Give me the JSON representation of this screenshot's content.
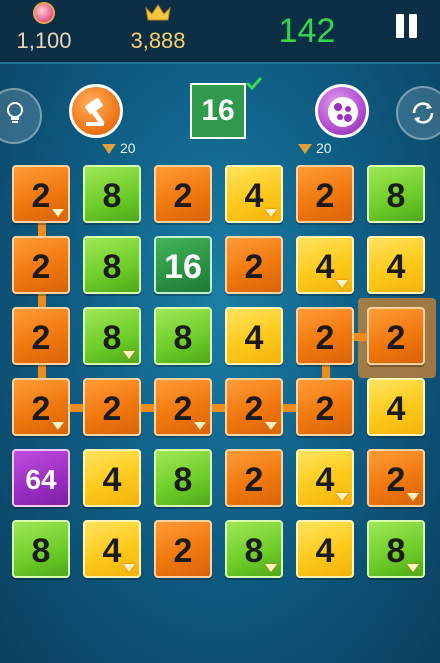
{
  "header": {
    "coins": "1,100",
    "best": "3,888",
    "score": "142"
  },
  "powerups": {
    "hammer_cost": "20",
    "shuffle_cost": "20",
    "target_tile": "16"
  },
  "colors": {
    "orange": "#f0780e",
    "green": "#6ccc28",
    "yellow": "#fdc91b",
    "dark_green": "#2c9444",
    "purple": "#9b2fc4",
    "score_green": "#32d84a"
  },
  "board": {
    "rows": [
      [
        {
          "v": "2",
          "c": "orange",
          "gem": true
        },
        {
          "v": "8",
          "c": "green",
          "gem": false
        },
        {
          "v": "2",
          "c": "orange",
          "gem": false
        },
        {
          "v": "4",
          "c": "yellow",
          "gem": true
        },
        {
          "v": "2",
          "c": "orange",
          "gem": false
        },
        {
          "v": "8",
          "c": "green",
          "gem": false
        }
      ],
      [
        {
          "v": "2",
          "c": "orange",
          "gem": false
        },
        {
          "v": "8",
          "c": "green",
          "gem": false
        },
        {
          "v": "16",
          "c": "dkgreen",
          "gem": false
        },
        {
          "v": "2",
          "c": "orange",
          "gem": false
        },
        {
          "v": "4",
          "c": "yellow",
          "gem": true
        },
        {
          "v": "4",
          "c": "yellow",
          "gem": false
        }
      ],
      [
        {
          "v": "2",
          "c": "orange",
          "gem": false
        },
        {
          "v": "8",
          "c": "green",
          "gem": true
        },
        {
          "v": "8",
          "c": "green",
          "gem": false
        },
        {
          "v": "4",
          "c": "yellow",
          "gem": false
        },
        {
          "v": "2",
          "c": "orange",
          "gem": false
        },
        {
          "v": "2",
          "c": "orange",
          "gem": false
        }
      ],
      [
        {
          "v": "2",
          "c": "orange",
          "gem": true
        },
        {
          "v": "2",
          "c": "orange",
          "gem": false
        },
        {
          "v": "2",
          "c": "orange",
          "gem": true
        },
        {
          "v": "2",
          "c": "orange",
          "gem": true
        },
        {
          "v": "2",
          "c": "orange",
          "gem": false
        },
        {
          "v": "4",
          "c": "yellow",
          "gem": false
        }
      ],
      [
        {
          "v": "64",
          "c": "purple",
          "gem": false
        },
        {
          "v": "4",
          "c": "yellow",
          "gem": false
        },
        {
          "v": "8",
          "c": "green",
          "gem": false
        },
        {
          "v": "2",
          "c": "orange",
          "gem": false
        },
        {
          "v": "4",
          "c": "yellow",
          "gem": true
        },
        {
          "v": "2",
          "c": "orange",
          "gem": true
        }
      ],
      [
        {
          "v": "8",
          "c": "green",
          "gem": false
        },
        {
          "v": "4",
          "c": "yellow",
          "gem": true
        },
        {
          "v": "2",
          "c": "orange",
          "gem": false
        },
        {
          "v": "8",
          "c": "green",
          "gem": true
        },
        {
          "v": "4",
          "c": "yellow",
          "gem": false
        },
        {
          "v": "8",
          "c": "green",
          "gem": true
        }
      ]
    ]
  }
}
